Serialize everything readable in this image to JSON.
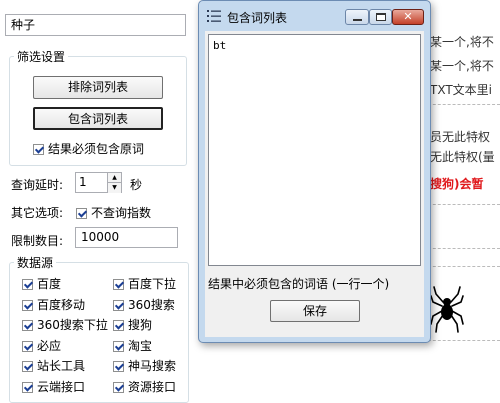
{
  "left_panel": {
    "seed_value": "种子",
    "filter_group": {
      "legend": "筛选设置",
      "exclude_button": "排除词列表",
      "include_button": "包含词列表",
      "must_include_label": "结果必须包含原词"
    },
    "query_delay": {
      "label": "查询延时:",
      "value": "1",
      "unit": "秒"
    },
    "other_options": {
      "label": "其它选项:",
      "no_index_label": "不查询指数"
    },
    "limit": {
      "label": "限制数目:",
      "value": "10000"
    },
    "data_source": {
      "legend": "数据源",
      "items": [
        {
          "label": "百度"
        },
        {
          "label": "百度下拉"
        },
        {
          "label": "百度移动"
        },
        {
          "label": "360搜索"
        },
        {
          "label": "360搜索下拉"
        },
        {
          "label": "搜狗"
        },
        {
          "label": "必应"
        },
        {
          "label": "淘宝"
        },
        {
          "label": "站长工具"
        },
        {
          "label": "神马搜索"
        },
        {
          "label": "云端接口"
        },
        {
          "label": "资源接口"
        }
      ]
    }
  },
  "background_page": {
    "line1": "的某一个,将不",
    "line2": "的某一个,将不",
    "line3": "在TXT文本里i",
    "line4": "会员无此特权",
    "line5": "员无此特权(量",
    "line6": "是搜狗)会暂"
  },
  "dialog": {
    "title": "包含词列表",
    "textarea_value": "bt",
    "hint": "结果中必须包含的词语 (一行一个)",
    "save_button": "保存"
  },
  "colors": {
    "accent_red": "#e0191c",
    "dialog_frame": "#c4d9ee"
  }
}
